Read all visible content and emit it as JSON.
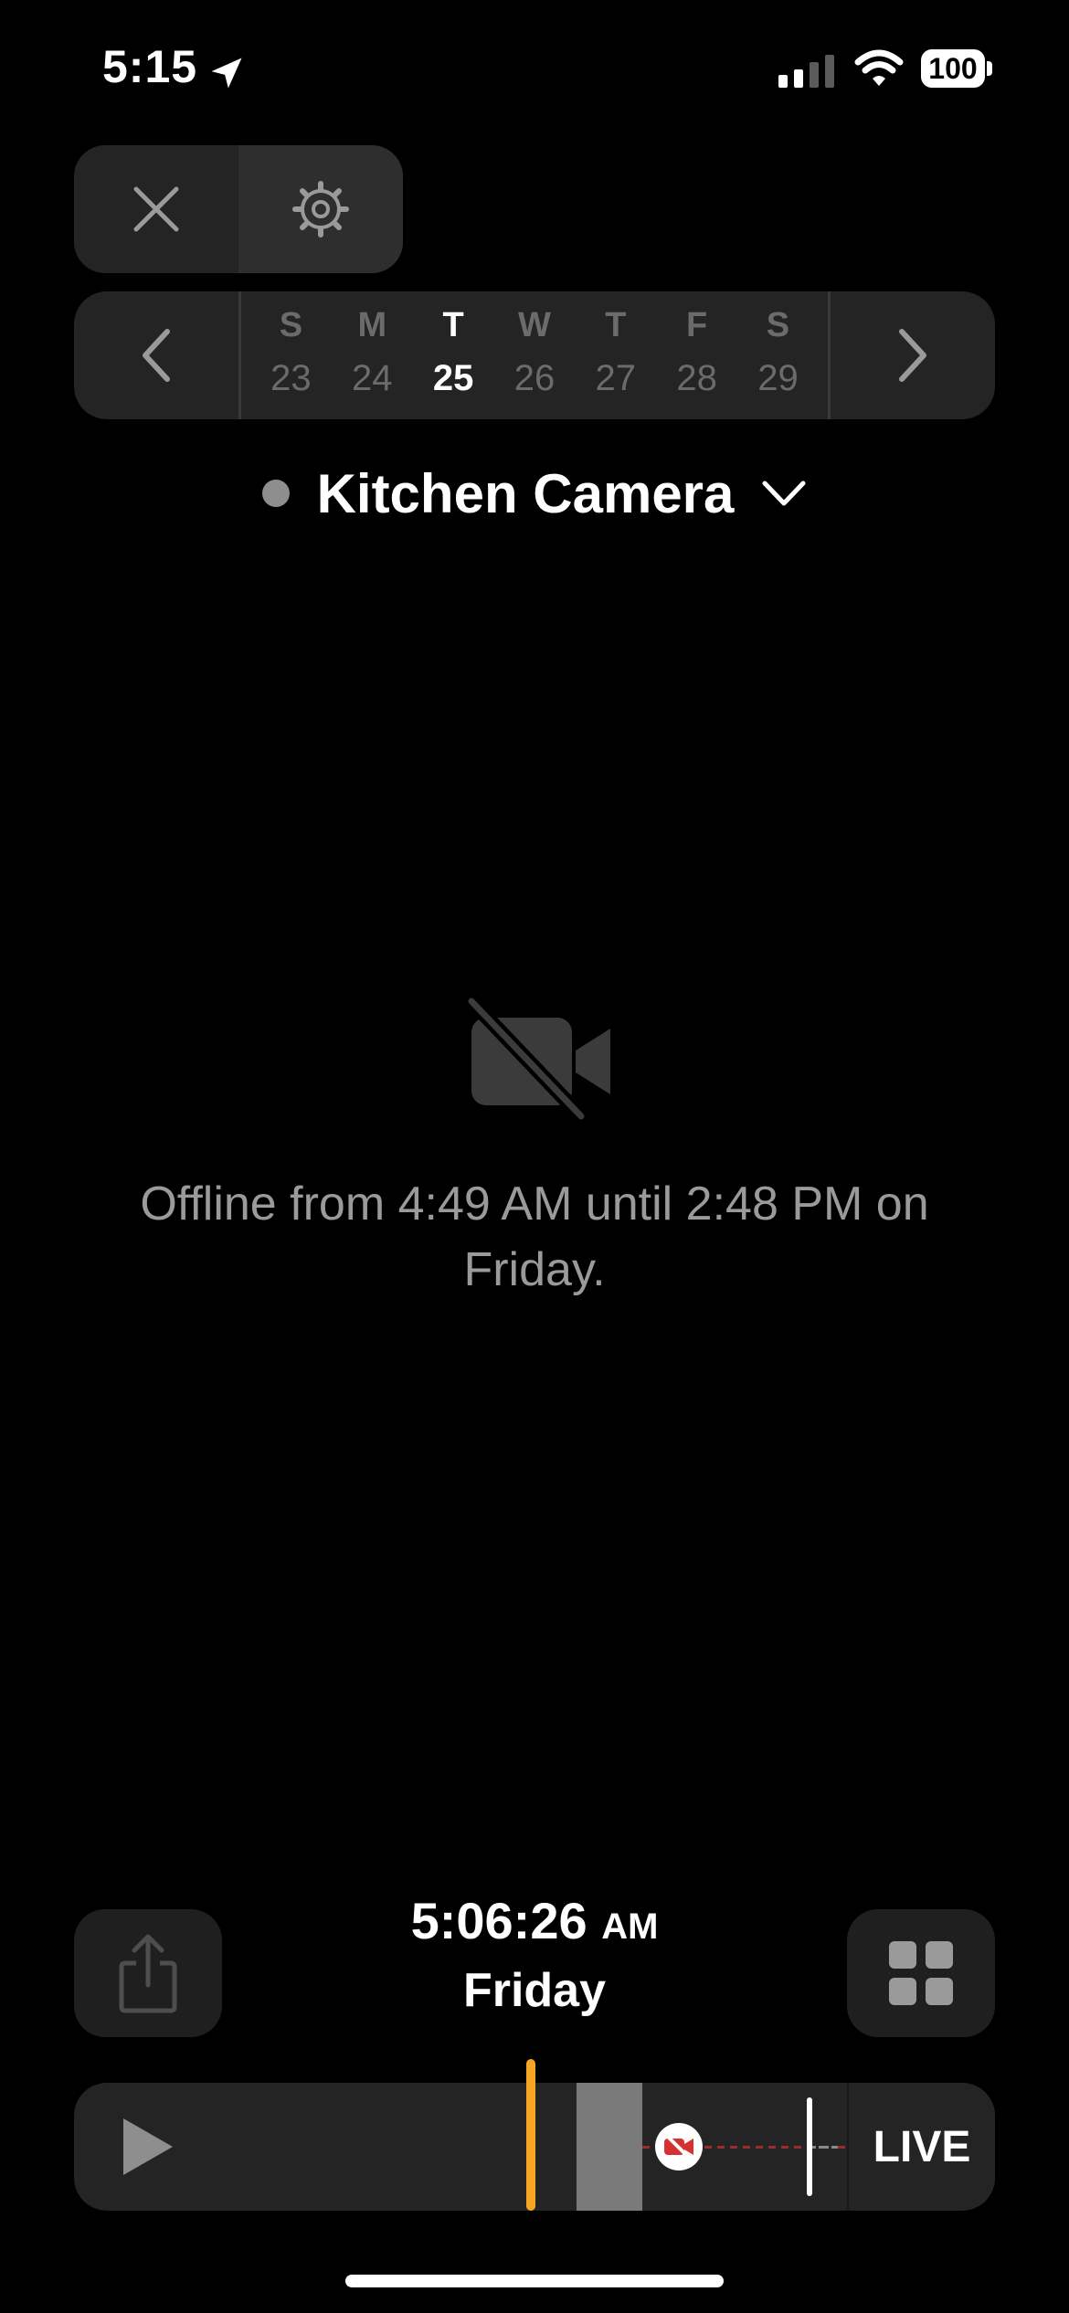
{
  "status_bar": {
    "time": "5:15",
    "battery": "100",
    "icons": [
      "location-arrow-icon",
      "cellular-signal-icon",
      "wifi-icon",
      "battery-icon"
    ]
  },
  "top_controls": {
    "icons": [
      "close-icon",
      "settings-gear-icon"
    ]
  },
  "week": {
    "days": [
      {
        "letter": "S",
        "number": "23"
      },
      {
        "letter": "M",
        "number": "24"
      },
      {
        "letter": "T",
        "number": "25"
      },
      {
        "letter": "W",
        "number": "26"
      },
      {
        "letter": "T",
        "number": "27"
      },
      {
        "letter": "F",
        "number": "28"
      },
      {
        "letter": "S",
        "number": "29"
      }
    ],
    "selected_index": 2,
    "icons": [
      "chevron-left-icon",
      "chevron-right-icon"
    ]
  },
  "camera": {
    "name": "Kitchen Camera",
    "status_color": "#8e8e8e",
    "icons": [
      "status-dot",
      "chevron-down-icon"
    ]
  },
  "offline": {
    "message": "Offline from 4:49 AM until 2:48 PM on Friday.",
    "icon": "video-off-icon"
  },
  "playback": {
    "time": "5:06:26",
    "ampm": "AM",
    "day": "Friday",
    "icons": [
      "share-icon",
      "grid-icon"
    ]
  },
  "timeline": {
    "live_label": "LIVE",
    "accent_color": "#f5a623",
    "icons": [
      "play-icon",
      "camera-offline-event-icon"
    ]
  }
}
